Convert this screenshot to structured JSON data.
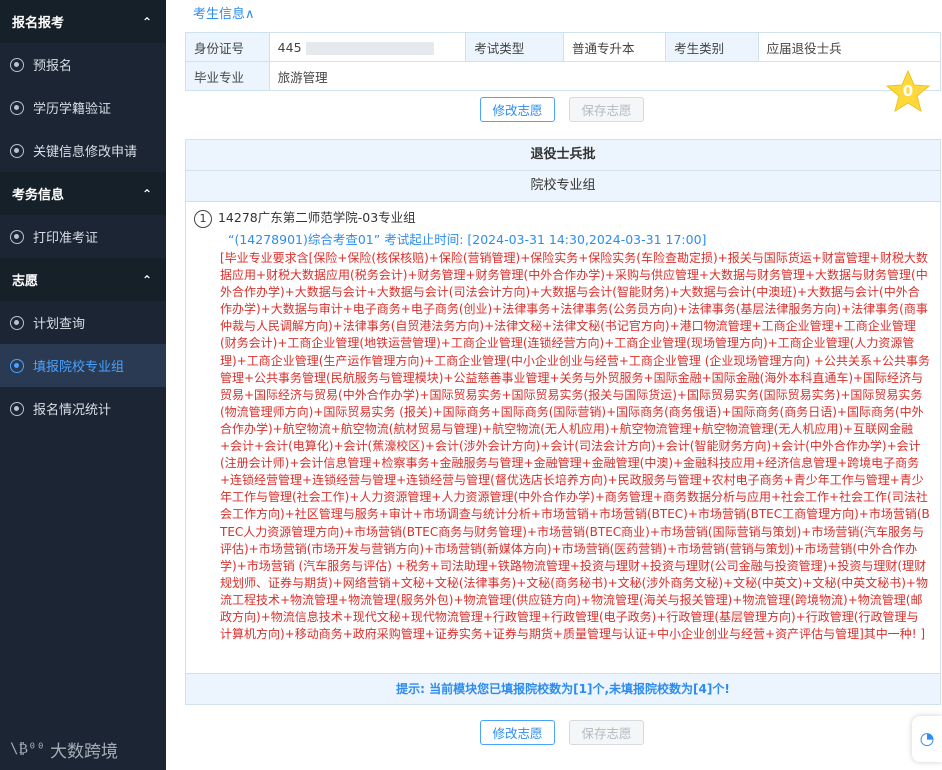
{
  "sidebar": {
    "sections": [
      {
        "title": "报名报考",
        "items": [
          "预报名",
          "学历学籍验证",
          "关键信息修改申请"
        ]
      },
      {
        "title": "考务信息",
        "items": [
          "打印准考证"
        ]
      },
      {
        "title": "志愿",
        "items": [
          "计划查询",
          "填报院校专业组",
          "报名情况统计"
        ]
      }
    ],
    "active_item": "填报院校专业组",
    "logo_text": "大数跨境",
    "logo_mark": "\\₿⁰⁰"
  },
  "page": {
    "top_link": "考生信息∧",
    "info": {
      "id_label": "身份证号",
      "id_value": "445",
      "exam_type_label": "考试类型",
      "exam_type_value": "普通专升本",
      "category_label": "考生类别",
      "category_value": "应届退役士兵",
      "major_label": "毕业专业",
      "major_value": "旅游管理"
    },
    "buttons": {
      "edit": "修改志愿",
      "save": "保存志愿"
    },
    "star_count": "0",
    "batch_title": "退役士兵批",
    "group_header": "院校专业组",
    "entry": {
      "index": "1",
      "school": "14278广东第二师范学院-03专业组",
      "exam": "“(14278901)综合考查01” 考试起止时间: [2024-03-31 14:30,2024-03-31 17:00]",
      "requirement": "[毕业专业要求含[保险+保险(核保核赔)+保险(营销管理)+保险实务+保险实务(车险查勘定损)+报关与国际货运+财富管理+财税大数据应用+财税大数据应用(税务会计)+财务管理+财务管理(中外合作办学)+采购与供应管理+大数据与财务管理+大数据与财务管理(中外合作办学)+大数据与会计+大数据与会计(司法会计方向)+大数据与会计(智能财务)+大数据与会计(中澳班)+大数据与会计(中外合作办学)+大数据与审计+电子商务+电子商务(创业)+法律事务+法律事务(公务员方向)+法律事务(基层法律服务方向)+法律事务(商事仲裁与人民调解方向)+法律事务(自贸港法务方向)+法律文秘+法律文秘(书记官方向)+港口物流管理+工商企业管理+工商企业管理(财务会计)+工商企业管理(地铁运营管理)+工商企业管理(连锁经营方向)+工商企业管理(现场管理方向)+工商企业管理(人力资源管理)+工商企业管理(生产运作管理方向)+工商企业管理(中小企业创业与经营+工商企业管理 (企业现场管理方向) +公共关系+公共事务管理+公共事务管理(民航服务与管理模块)+公益慈善事业管理+关务与外贸服务+国际金融+国际金融(海外本科直通车)+国际经济与贸易+国际经济与贸易(中外合作办学)+国际贸易实务+国际贸易实务(报关与国际货运)+国际贸易实务(国际贸易实务)+国际贸易实务(物流管理师方向)+国际贸易实务 (报关)+国际商务+国际商务(国际营销)+国际商务(商务俄语)+国际商务(商务日语)+国际商务(中外合作办学)+航空物流+航空物流(航材贸易与管理)+航空物流(无人机应用)+航空物流管理+航空物流管理(无人机应用)+互联网金融+会计+会计(电算化)+会计(蕉濠校区)+会计(涉外会计方向)+会计(司法会计方向)+会计(智能财务方向)+会计(中外合作办学)+会计(注册会计师)+会计信息管理+检察事务+金融服务与管理+金融管理+金融管理(中澳)+金融科技应用+经济信息管理+跨境电子商务+连锁经营管理+连锁经营与管理+连锁经营与管理(督优选店长培养方向)+民政服务与管理+农村电子商务+青少年工作与管理+青少年工作与管理(社会工作)+人力资源管理+人力资源管理(中外合作办学)+商务管理+商务数据分析与应用+社会工作+社会工作(司法社会工作方向)+社区管理与服务+审计+市场调查与统计分析+市场营销+市场营销(BTEC)+市场营销(BTEC工商管理方向)+市场营销(BTEC人力资源管理方向)+市场营销(BTEC商务与财务管理)+市场营销(BTEC商业)+市场营销(国际营销与策划)+市场营销(汽车服务与评估)+市场营销(市场开发与营销方向)+市场营销(新媒体方向)+市场营销(医药营销)+市场营销(营销与策划)+市场营销(中外合作办学)+市场营销 (汽车服务与评估) +税务+司法助理+铁路物流管理+投资与理财+投资与理财(公司金融与投资管理)+投资与理财(理财规划师、证券与期货)+网络营销+文秘+文秘(法律事务)+文秘(商务秘书)+文秘(涉外商务文秘)+文秘(中英文)+文秘(中英文秘书)+物流工程技术+物流管理+物流管理(服务外包)+物流管理(供应链方向)+物流管理(海关与报关管理)+物流管理(跨境物流)+物流管理(邮政方向)+物流信息技术+现代文秘+现代物流管理+行政管理+行政管理(电子政务)+行政管理(基层管理方向)+行政管理(行政管理与计算机方向)+移动商务+政府采购管理+证券实务+证券与期货+质量管理与认证+中小企业创业与经营+资产评估与管理]其中一种! ]"
    },
    "tip": "提示: 当前模块您已填报院校数为[1]个,未填报院校数为[4]个!",
    "colors": {
      "accent": "#2d8cf0",
      "requirement": "#d9302c",
      "sidebar_bg": "#1b2533",
      "star": "#ffd93b"
    }
  }
}
